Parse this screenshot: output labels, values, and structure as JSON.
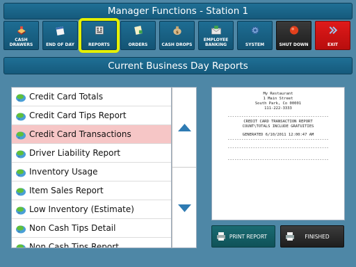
{
  "window": {
    "title": "Manager Functions - Station 1"
  },
  "toolbar": {
    "buttons": [
      {
        "label": "CASH\nDRAWERS",
        "icon": "cash-drawer-icon"
      },
      {
        "label": "END OF DAY",
        "icon": "calendar-icon"
      },
      {
        "label": "REPORTS",
        "icon": "reports-icon",
        "selected": true
      },
      {
        "label": "ORDERS",
        "icon": "orders-icon"
      },
      {
        "label": "CASH DROPS",
        "icon": "money-bag-icon"
      },
      {
        "label": "EMPLOYEE\nBANKING",
        "icon": "envelope-icon"
      },
      {
        "label": "SYSTEM",
        "icon": "gear-icon"
      },
      {
        "label": "SHUT DOWN",
        "icon": "stop-icon"
      },
      {
        "label": "EXIT",
        "icon": "exit-icon"
      }
    ]
  },
  "section": {
    "title": "Current Business Day Reports"
  },
  "reports": {
    "items": [
      "Credit Card Totals",
      "Credit Card Tips Report",
      "Credit Card Transactions",
      "Driver Liability Report",
      "Inventory Usage",
      "Item Sales Report",
      "Low Inventory (Estimate)",
      "Non Cash Tips Detail",
      "Non Cash Tips Report"
    ],
    "selected": "Credit Card Transactions"
  },
  "receipt": {
    "header": [
      "My Restaurant",
      "1 Main Street",
      "South Park, Co 00001",
      "111-222-3333"
    ],
    "divider": "--------------------------------------------",
    "report_title": "CREDIT CARD TRANSACTION REPORT",
    "report_note": "COUNT\\TOTALS INCLUDE GRATUITIES",
    "generated": "GENERATED 6/10/2011 12:00:47 AM"
  },
  "actions": {
    "print_label": "PRINT REPORT",
    "finished_label": "FINISHED"
  },
  "colors": {
    "background": "#4e87a6",
    "bar": "#1a658a",
    "selected_row": "#f6c6c6",
    "highlight": "#e5f000",
    "shutdown": "#2a2a2a",
    "exit": "#d01414",
    "scroll_arrow": "#2e7bb3"
  }
}
